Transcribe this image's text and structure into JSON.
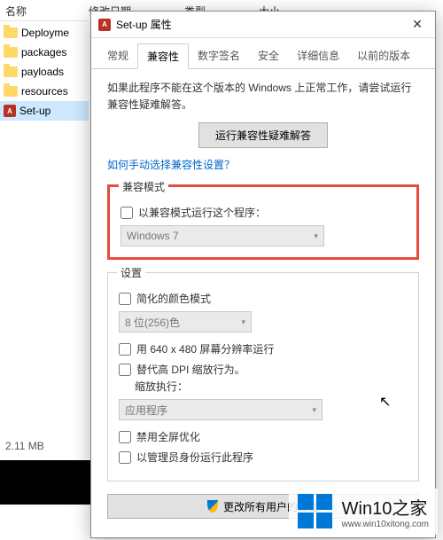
{
  "explorer": {
    "cols": {
      "name": "名称",
      "date": "修改日期",
      "type": "类型",
      "size": "大小"
    },
    "files": [
      "Deployme",
      "packages",
      "payloads",
      "resources",
      "Set-up"
    ],
    "selected_size": "2.11 MB"
  },
  "dialog": {
    "title": "Set-up 属性",
    "tabs": {
      "general": "常规",
      "compat": "兼容性",
      "sig": "数字签名",
      "security": "安全",
      "details": "详细信息",
      "prev": "以前的版本"
    },
    "intro": "如果此程序不能在这个版本的 Windows 上正常工作，请尝试运行兼容性疑难解答。",
    "troubleshoot_btn": "运行兼容性疑难解答",
    "link": "如何手动选择兼容性设置？",
    "compat": {
      "group_title": "兼容模式",
      "check_label": "以兼容模式运行这个程序：",
      "select_value": "Windows 7"
    },
    "settings": {
      "group_title": "设置",
      "reduced_color": "简化的颜色模式",
      "color_value": "8 位(256)色",
      "res_640": "用 640 x 480 屏幕分辨率运行",
      "dpi_override": "替代高 DPI 缩放行为。",
      "dpi_sub": "缩放执行：",
      "dpi_value": "应用程序",
      "fullscreen_opt": "禁用全屏优化",
      "admin": "以管理员身份运行此程序"
    },
    "all_users": "更改所有用户的设置"
  },
  "watermark": {
    "title": "Win10之家",
    "url": "www.win10xitong.com"
  }
}
